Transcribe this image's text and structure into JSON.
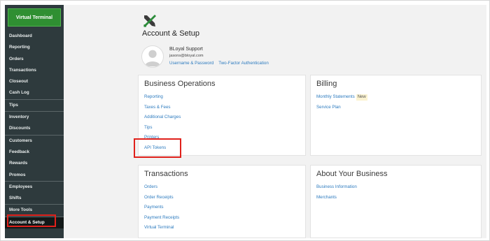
{
  "sidebar": {
    "virtual_terminal": "Virtual Terminal",
    "items": [
      {
        "label": "Dashboard"
      },
      {
        "label": "Reporting"
      },
      {
        "label": "Orders"
      },
      {
        "label": "Transactions"
      },
      {
        "label": "Closeout"
      },
      {
        "label": "Cash Log"
      },
      {
        "label": "Tips"
      },
      {
        "label": "Inventory"
      },
      {
        "label": "Discounts"
      },
      {
        "label": "Customers"
      },
      {
        "label": "Feedback"
      },
      {
        "label": "Rewards"
      },
      {
        "label": "Promos"
      },
      {
        "label": "Employees"
      },
      {
        "label": "Shifts"
      },
      {
        "label": "More Tools"
      },
      {
        "label": "Account & Setup"
      }
    ]
  },
  "header": {
    "icon": "wrench-screwdriver-icon",
    "title": "Account & Setup"
  },
  "profile": {
    "name": "BLoyal Support",
    "email": "jasons@bloyal.com",
    "links": [
      "Username & Password",
      "Two-Factor Authentication"
    ]
  },
  "cards": {
    "business_operations": {
      "title": "Business Operations",
      "links": [
        "Reporting",
        "Taxes & Fees",
        "Additional Charges",
        "Tips",
        "Printers",
        "API Tokens"
      ]
    },
    "billing": {
      "title": "Billing",
      "statements": "Monthly Statements",
      "new_badge": "New",
      "service_plan": "Service Plan"
    },
    "transactions": {
      "title": "Transactions",
      "links": [
        "Orders",
        "Order Receipts",
        "Payments",
        "Payment Receipts",
        "Virtual Terminal"
      ]
    },
    "about": {
      "title": "About Your Business",
      "links": [
        "Business Information",
        "Merchants"
      ]
    }
  },
  "colors": {
    "sidebar_bg": "#2e3a3d",
    "accent_green": "#2f8f32",
    "link_blue": "#2d7bbf",
    "highlight_red": "#e0211b"
  }
}
